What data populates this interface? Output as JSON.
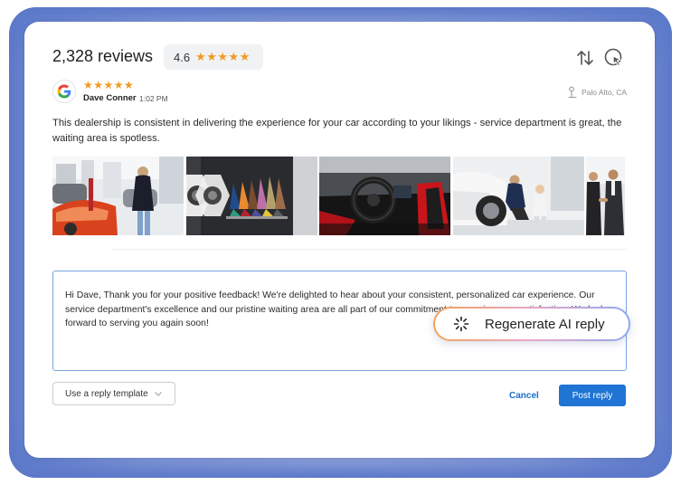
{
  "header": {
    "reviews_count": "2,328 reviews",
    "rating_value": "4.6",
    "rating_stars": "★★★★★"
  },
  "icons": {
    "sort": "sort-arrows-icon",
    "auto_reply": "cursor-click-icon",
    "source": "google-icon",
    "location": "map-pin-icon",
    "sparkle": "sparkle-loading-icon",
    "chevron": "chevron-down-icon"
  },
  "review": {
    "stars": "★★★★★",
    "author": "Dave Conner",
    "time": "1:02 PM",
    "location": "Palo Alto, CA",
    "text": "This dealership is consistent in delivering the experience for your car according to your likings -  service department is great, the waiting area is spotless.",
    "photo_count": 5
  },
  "reply": {
    "text": "Hi Dave, Thank you for your positive feedback! We're delighted to hear about your consistent, personalized car experience. Our service department's excellence and our pristine waiting area are all part of our commitment to ensuring your satisfaction. We look forward to serving you again soon!",
    "template_label": "Use a reply template",
    "cancel_label": "Cancel",
    "post_label": "Post reply",
    "regenerate_label": "Regenerate AI reply"
  },
  "colors": {
    "star": "#f29a21",
    "primary": "#1f74d4",
    "reply_border": "#7aa4df"
  }
}
